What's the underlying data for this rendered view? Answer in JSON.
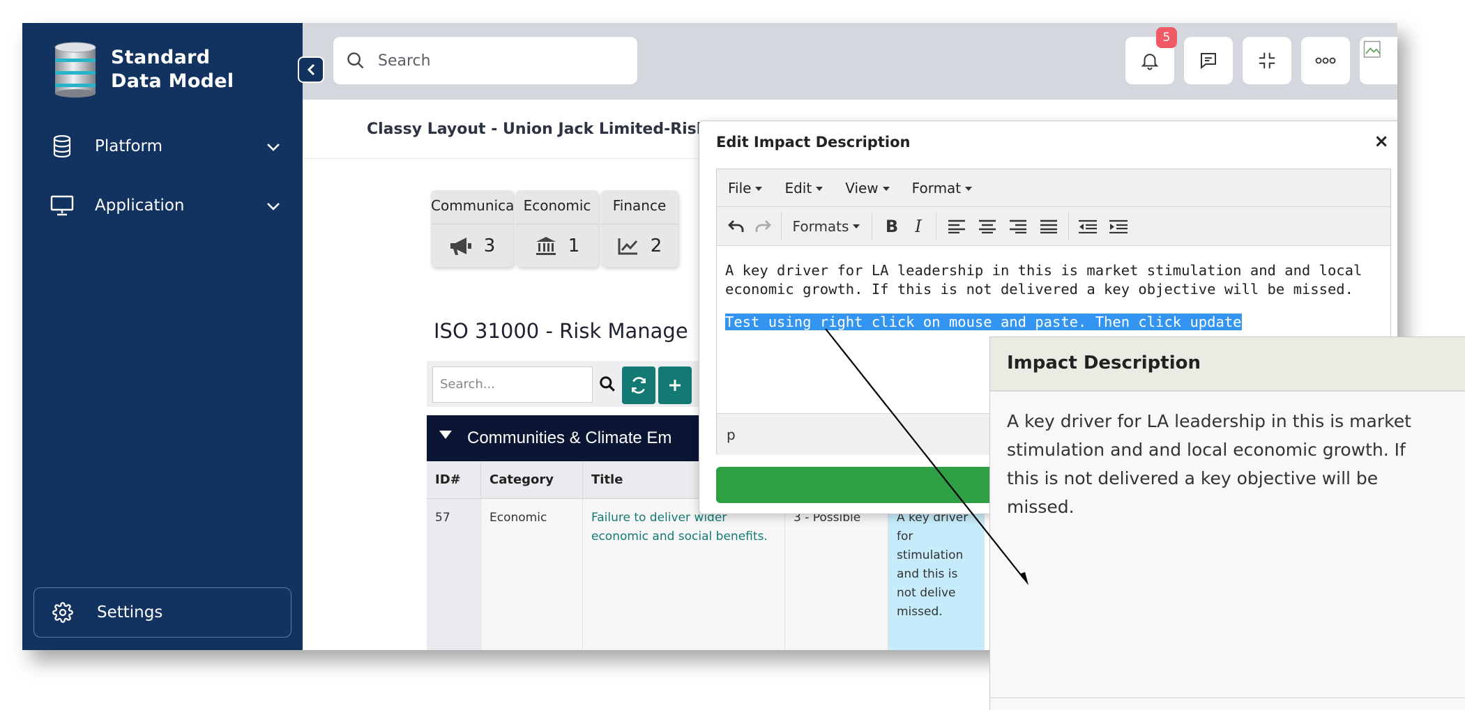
{
  "brand": {
    "line1": "Standard",
    "line2": "Data Model"
  },
  "sidebar": {
    "items": [
      {
        "label": "Platform",
        "icon": "database-icon"
      },
      {
        "label": "Application",
        "icon": "monitor-icon"
      }
    ],
    "settings_label": "Settings"
  },
  "topbar": {
    "search_placeholder": "Search",
    "notification_count": "5"
  },
  "page": {
    "title": "Classy Layout - Union Jack Limited-Risk",
    "categories": [
      {
        "label": "Communica",
        "count": "3",
        "icon": "megaphone-icon"
      },
      {
        "label": "Economic",
        "count": "1",
        "icon": "bank-icon"
      },
      {
        "label": "Finance",
        "count": "2",
        "icon": "chart-icon"
      }
    ],
    "section_title": "ISO 31000 - Risk Manage",
    "table_search_placeholder": "Search...",
    "group_label": "Communities & Climate Em",
    "table": {
      "headers": [
        "ID#",
        "Category",
        "Title",
        "",
        ""
      ],
      "row": {
        "id": "57",
        "category": "Economic",
        "title": "Failure to deliver wider economic and social benefits.",
        "likelihood": "3 - Possible",
        "impact": "A key driver for stimulation and this is not delive missed."
      }
    }
  },
  "dialog": {
    "title": "Edit Impact Description",
    "close": "×",
    "menus": [
      "File",
      "Edit",
      "View",
      "Format"
    ],
    "formats_label": "Formats",
    "bold": "B",
    "italic": "I",
    "paragraph1": "A key driver for LA leadership in this is market stimulation and and local economic growth. If this is not delivered a key objective will be missed.",
    "paragraph2": "Test using right click on mouse and paste. Then click update",
    "status_path": "p"
  },
  "zoom": {
    "header": "Impact Description",
    "body": "A key driver for LA leadership in this is market stimulation and and local economic growth. If this is not delivered a key objective will be missed."
  },
  "colors": {
    "sidebar": "#123260",
    "accent_teal": "#137a73",
    "update_green": "#2ea043",
    "selection": "#3495f0",
    "badge": "#f05a64"
  }
}
